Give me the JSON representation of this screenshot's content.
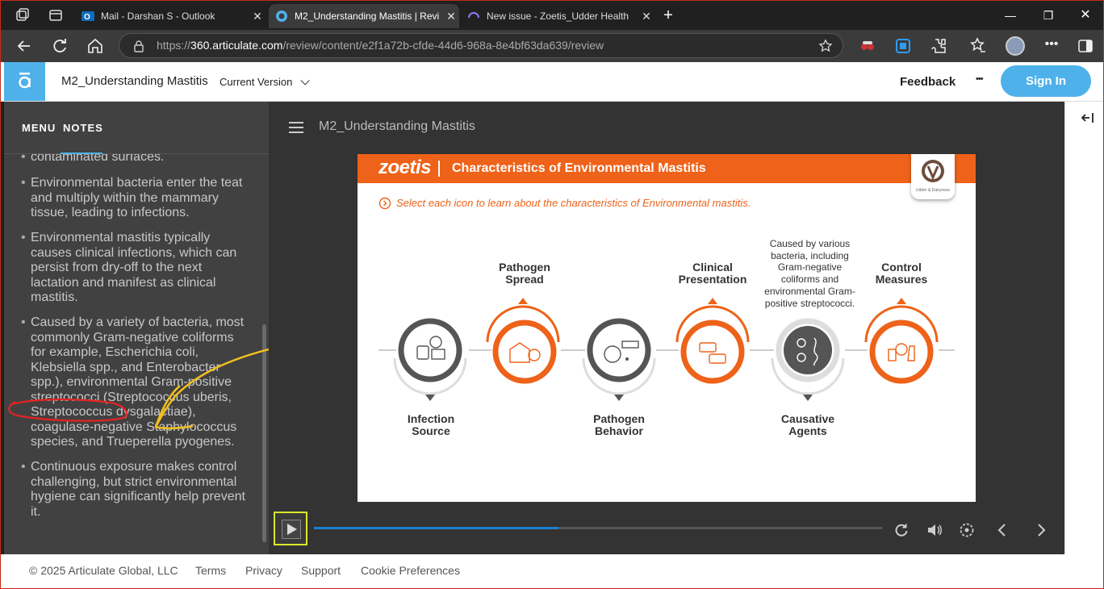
{
  "browser": {
    "tabs": [
      {
        "title": "Mail - Darshan S - Outlook",
        "active": false
      },
      {
        "title": "M2_Understanding Mastitis | Revi",
        "active": true
      },
      {
        "title": "New issue - Zoetis_Udder Health",
        "active": false
      }
    ],
    "url_prefix": "https://",
    "url_host": "360.articulate.com",
    "url_path": "/review/content/e2f1a72b-cfde-44d6-968a-8e4bf63da639/review"
  },
  "app": {
    "course_title": "M2_Understanding Mastitis",
    "version_label": "Current Version",
    "feedback_label": "Feedback",
    "more_label": "•••",
    "signin_label": "Sign In"
  },
  "sidebar": {
    "tabs": [
      "MENU",
      "NOTES"
    ],
    "notes": [
      "contaminated surfaces.",
      "Environmental bacteria enter the teat and multiply within the mammary tissue, leading to infections.",
      "Environmental mastitis typically causes clinical infections, which can persist from dry-off to the next lactation and manifest as clinical mastitis.",
      "Caused by a variety of bacteria, most commonly Gram-negative coliforms for example, Escherichia coli, Klebsiella spp., and Enterobacter spp.), environmental Gram-positive streptococci (Streptococcus uberis, Streptococcus dysgalactiae), coagulase-negative Staphylococcus species, and Trueperella pyogenes.",
      "Continuous exposure makes control challenging, but strict environmental hygiene can significantly help prevent it."
    ]
  },
  "player": {
    "title": "M2_Understanding Mastitis",
    "progress": 0.43,
    "slide": {
      "brand": "zoetis",
      "heading": "Characteristics of Environmental Mastitis",
      "instruction": "Select each icon to learn about the characteristics of Environmental mastitis.",
      "badge_caption": "Udder & Dairyness",
      "items": [
        {
          "label": "Infection Source",
          "state": "grey"
        },
        {
          "label": "Pathogen Spread",
          "state": "orange"
        },
        {
          "label": "Pathogen Behavior",
          "state": "grey"
        },
        {
          "label": "Clinical Presentation",
          "state": "orange"
        },
        {
          "label": "Causative Agents",
          "state": "selected"
        },
        {
          "label": "Control Measures",
          "state": "orange"
        }
      ],
      "tooltip": "Caused by various bacteria, including Gram-negative coliforms and environmental Gram-positive streptococci."
    }
  },
  "footer": {
    "copyright": "© 2025 Articulate Global, LLC",
    "links": [
      "Terms",
      "Privacy",
      "Support",
      "Cookie Preferences"
    ]
  },
  "colors": {
    "accent_blue": "#4fb1e9",
    "zoetis_orange": "#ee6219",
    "annot_red": "#e52222",
    "annot_yellow": "#f2c01e"
  }
}
